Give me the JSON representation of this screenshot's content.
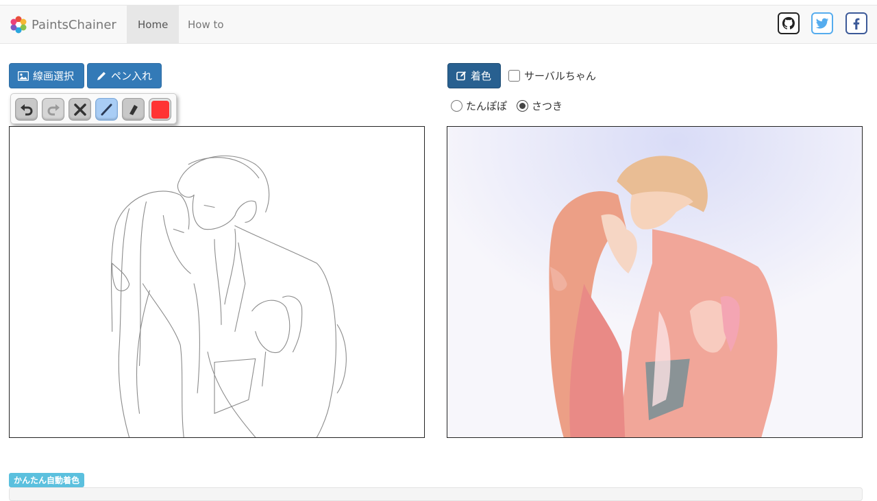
{
  "navbar": {
    "brand": "PaintsChainer",
    "nav": [
      {
        "label": "Home",
        "active": true
      },
      {
        "label": "How to",
        "active": false
      }
    ],
    "social_icons": [
      "github-icon",
      "twitter-icon",
      "facebook-icon"
    ]
  },
  "left_panel": {
    "select_button": "線画選択",
    "pen_button": "ペン入れ",
    "toolbar": {
      "tools": [
        "undo-icon",
        "redo-icon",
        "clear-icon",
        "pen-icon",
        "eraser-icon",
        "color-swatch"
      ],
      "selected_tool": "pen-icon",
      "current_color": "#ff3333"
    }
  },
  "right_panel": {
    "colorize_button": "着色",
    "checkbox_label": "サーバルちゃん",
    "checkbox_checked": false,
    "radios": [
      {
        "label": "たんぽぽ",
        "checked": false
      },
      {
        "label": "さつき",
        "checked": true
      }
    ]
  },
  "bottom": {
    "badge": "かんたん自動着色"
  },
  "colors": {
    "primary": "#337ab7",
    "primary_dark": "#286090",
    "info": "#5bc0de",
    "pen_active": "#a9cdf5"
  }
}
